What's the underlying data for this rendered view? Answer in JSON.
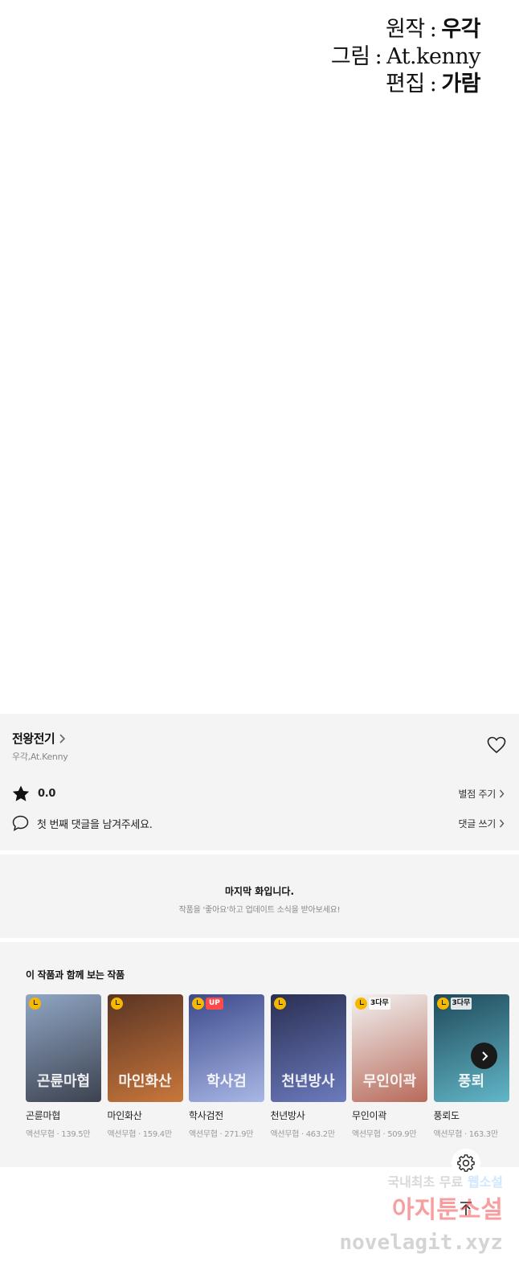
{
  "credits": [
    {
      "role": "원작",
      "sep": ":",
      "name": "우각"
    },
    {
      "role": "그림",
      "sep": ":",
      "name": "At.kenny"
    },
    {
      "role": "편집",
      "sep": ":",
      "name": "가람"
    }
  ],
  "series": {
    "title": "전왕전기",
    "authors": "우각,At.Kenny"
  },
  "rating": {
    "value": "0.0",
    "action": "별점 주기"
  },
  "comment": {
    "prompt": "첫 번째 댓글을 남겨주세요.",
    "action": "댓글 쓰기"
  },
  "last_episode": {
    "title": "마지막 화입니다.",
    "subtitle": "작품을 '좋아요'하고 업데이트 소식을 받아보세요!"
  },
  "recommendations": {
    "heading": "이 작품과 함께 보는 작품",
    "items": [
      {
        "title": "곤륜마협",
        "meta": "액션무협 · 139.5만",
        "badge": "",
        "art": "곤륜마협",
        "colors": [
          "#8fa6c4",
          "#3d4250"
        ]
      },
      {
        "title": "마인화산",
        "meta": "액션무협 · 159.4만",
        "badge": "",
        "art": "마인화산",
        "colors": [
          "#5a3424",
          "#c9773b"
        ]
      },
      {
        "title": "학사검전",
        "meta": "액션무협 · 271.9만",
        "badge": "UP",
        "art": "학사검",
        "colors": [
          "#3c4a8c",
          "#a9b7e6"
        ]
      },
      {
        "title": "천년방사",
        "meta": "액션무협 · 463.2만",
        "badge": "",
        "art": "천년방사",
        "colors": [
          "#2a2f52",
          "#6c7bbf"
        ]
      },
      {
        "title": "무인이곽",
        "meta": "액션무협 · 509.9만",
        "badge": "3다무",
        "art": "무인이곽",
        "colors": [
          "#f2f2f2",
          "#b86a5a"
        ]
      },
      {
        "title": "풍뢰도",
        "meta": "액션무협 · 163.3만",
        "badge": "3다무",
        "art": "풍뢰",
        "colors": [
          "#1f4a5a",
          "#62b6c8"
        ]
      }
    ]
  },
  "watermark": {
    "line1_prefix": "국내최초 무료 ",
    "line1_highlight": "웹소설",
    "line2": "아지툰소설",
    "line3": "novelagit.xyz"
  },
  "icons": {
    "heart": "heart-icon",
    "star": "star-icon",
    "comment": "comment-icon",
    "settings": "gear-icon",
    "scroll_top": "arrow-up-icon",
    "next": "chevron-right-icon"
  }
}
